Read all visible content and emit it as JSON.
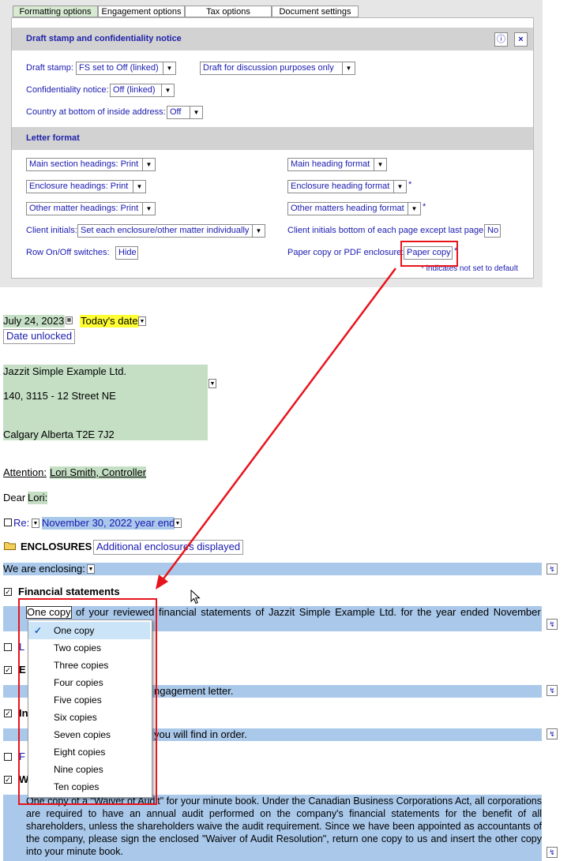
{
  "tabs": [
    {
      "label": "Formatting options"
    },
    {
      "label": "Engagement options"
    },
    {
      "label": "Tax options"
    },
    {
      "label": "Document settings"
    }
  ],
  "draft_section": {
    "title": "Draft stamp and confidentiality notice",
    "info_glyph": "ⓘ",
    "close_glyph": "×",
    "draft_stamp_label": "Draft stamp:",
    "draft_stamp_value": "FS set to Off (linked)",
    "draft_text_value": "Draft for discussion purposes only",
    "confidentiality_label": "Confidentiality notice:",
    "confidentiality_value": "Off (linked)",
    "country_label": "Country at bottom of inside address:",
    "country_value": "Off"
  },
  "letter_format": {
    "title": "Letter format",
    "main_section_headings": "Main section headings: Print",
    "main_heading_format": "Main heading format",
    "enclosure_headings": "Enclosure headings: Print",
    "enclosure_heading_format": "Enclosure heading format",
    "other_matter_headings": "Other matter headings: Print",
    "other_matters_heading_format": "Other matters heading format",
    "client_initials_label": "Client initials:",
    "client_initials_value": "Set each enclosure/other matter individually",
    "client_initials_bottom_label": "Client initials bottom of each page except last page:",
    "client_initials_bottom_value": "No",
    "row_switches_label": "Row On/Off switches:",
    "row_switches_value": "Hide",
    "paper_copy_label": "Paper copy or PDF enclosure:",
    "paper_copy_value": "Paper copy",
    "star": "*",
    "footnote": "* indicates not set to default"
  },
  "letter": {
    "date": "July 24, 2023",
    "todays_date": "Today's date",
    "date_unlocked": "Date unlocked",
    "address": [
      "Jazzit Simple Example Ltd.",
      "140, 3115 - 12 Street NE",
      "Calgary Alberta  T2E 7J2"
    ],
    "attention_label": "Attention:",
    "attention_value": "Lori Smith, Controller",
    "dear_label": "Dear",
    "dear_value": "Lori:",
    "re_label": "Re:",
    "re_value": "November 30, 2022 year end",
    "enclosures_heading": "ENCLOSURES",
    "additional_enclosures": "Additional enclosures displayed",
    "we_are_enclosing": "We are enclosing:",
    "financial_statements": "Financial statements",
    "one_copy": "One copy",
    "fs_text": "of your reviewed financial statements of Jazzit Simple Example Ltd.    for the year ended November",
    "partial_l": "L",
    "partial_e": "E",
    "engagement_text": "ngagement letter.",
    "partial_in": "In",
    "order_text": "you will find in order.",
    "partial_f": "F",
    "partial_w": "W",
    "waiver_text": "One copy of a \"Waiver of Audit\" for your minute book.  Under the Canadian Business Corporations Act, all corporations are required to have an annual audit performed on the company's financial statements for the benefit of all shareholders, unless the shareholders waive the audit requirement.  Since we have been appointed as accountants of the company, please sign the enclosed \"Waiver of Audit Resolution\", return one copy to us and insert the other copy into your minute book."
  },
  "copies_menu": {
    "check_glyph": "✓",
    "items": [
      "One copy",
      "Two copies",
      "Three copies",
      "Four copies",
      "Five copies",
      "Six copies",
      "Seven copies",
      "Eight copies",
      "Nine copies",
      "Ten copies"
    ]
  },
  "colors": {
    "accent": "#1e22a9",
    "highlight_green": "#c5dfc5",
    "highlight_blue": "#a9c8ea",
    "annotation_red": "#e8141c",
    "yellow": "#ffff33"
  }
}
